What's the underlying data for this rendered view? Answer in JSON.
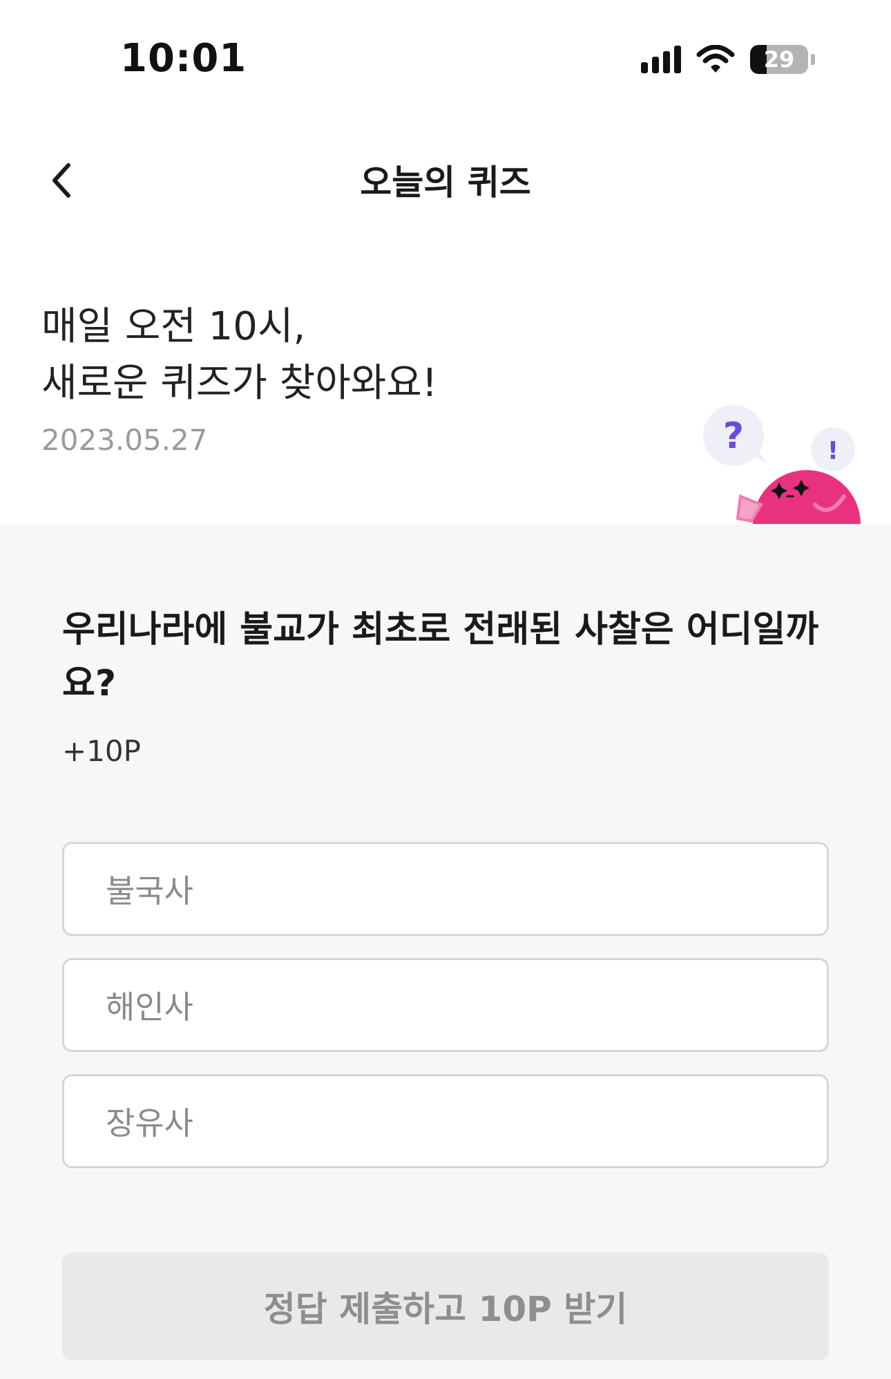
{
  "status_bar": {
    "time": "10:01",
    "battery_level": "29",
    "battery_fraction": 0.29,
    "icons": [
      "signal-icon",
      "wifi-icon",
      "battery-icon"
    ]
  },
  "nav": {
    "back_icon": "chevron-left-icon",
    "title": "오늘의 퀴즈"
  },
  "intro": {
    "line1": "매일 오전 10시,",
    "line2": "새로운 퀴즈가 찾아와요!",
    "date": "2023.05.27"
  },
  "mascot": {
    "question_mark": "?",
    "exclamation": "!",
    "colors": {
      "body": "#e8327f",
      "bubble": "#efeff7",
      "question": "#6a4bd6"
    }
  },
  "quiz": {
    "question": "우리나라에 불교가 최초로 전래된 사찰은 어디일까요?",
    "points": "+10P",
    "options": [
      "불국사",
      "해인사",
      "장유사"
    ],
    "submit_label": "정답 제출하고 10P 받기"
  },
  "colors": {
    "section_background": "#f7f7f7",
    "option_border": "#d6d6d6",
    "button_disabled": "#e9e9e9",
    "button_text_disabled": "#8e8e8e"
  }
}
